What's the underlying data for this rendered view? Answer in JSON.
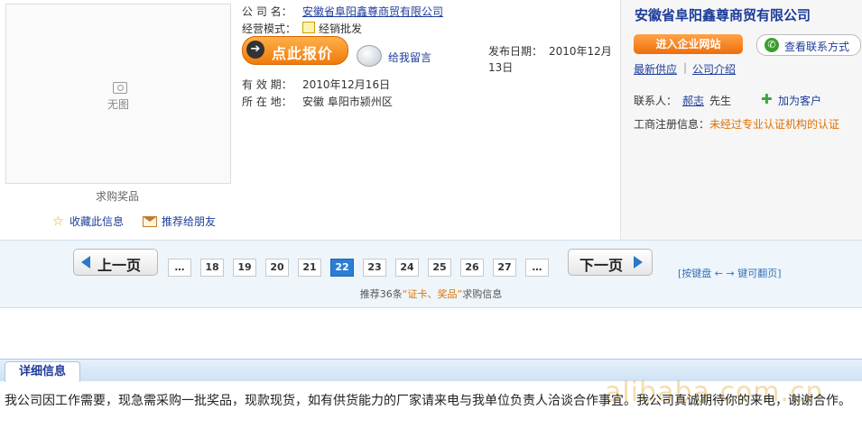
{
  "product": {
    "no_image_text": "无图",
    "name": "求购奖品",
    "favorite_label": "收藏此信息",
    "share_label": "推荐给朋友"
  },
  "info": {
    "company_label": "公 司 名：",
    "company_value": "安徽省阜阳鑫尊商贸有限公司",
    "mode_label": "经营模式：",
    "mode_value": "经销批发",
    "quote_button": "点此报价",
    "message_link": "给我留言",
    "publish_label": "发布日期：",
    "publish_value_line1": "2010年12月",
    "publish_value_line2": "13日",
    "valid_label": "有 效 期：",
    "valid_value": "2010年12月16日",
    "location_label": "所 在 地：",
    "location_value": "安徽 阜阳市颍州区"
  },
  "company_panel": {
    "title": "安徽省阜阳鑫尊商贸有限公司",
    "enter_site": "进入企业网站",
    "view_contact": "查看联系方式",
    "latest_supply": "最新供应",
    "separator": "|",
    "company_intro": "公司介绍",
    "contact_label": "联系人：",
    "contact_name": "郝志",
    "contact_title": "先生",
    "add_customer": "加为客户",
    "reg_label": "工商注册信息：",
    "reg_value": "未经过专业认证机构的认证"
  },
  "pager": {
    "prev": "上一页",
    "next": "下一页",
    "ellipsis": "…",
    "pages": [
      "18",
      "19",
      "20",
      "21",
      "22",
      "23",
      "24",
      "25",
      "26",
      "27"
    ],
    "current": "22",
    "keyboard_hint": "[按键盘 ← → 键可翻页]",
    "recommend_prefix": "推荐36条",
    "recommend_keyword": "“证卡、奖品”",
    "recommend_suffix": "求购信息"
  },
  "detail": {
    "tab_label": "详细信息",
    "text": "我公司因工作需要，现急需采购一批奖品，现款现货，如有供货能力的厂家请来电与我单位负责人洽谈合作事宜。我公司真诚期待你的来电，谢谢合作。",
    "watermark": "alibaba.com.cn"
  },
  "colors": {
    "link": "#1d3c9a",
    "accent_orange": "#f07a0a",
    "current_page": "#2a7ed6"
  }
}
